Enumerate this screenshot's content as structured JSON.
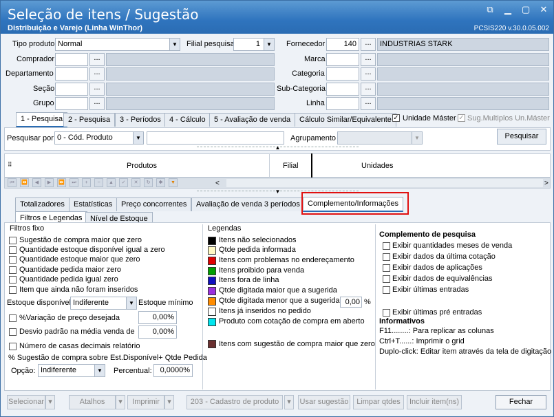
{
  "window": {
    "title": "Seleção de itens / Sugestão",
    "subtitle": "Distribuição e Varejo (Linha WinThor)",
    "version": "PCSIS220  v.30.0.05.002"
  },
  "filters": {
    "tipo_produto": {
      "label": "Tipo produto",
      "value": "Normal"
    },
    "filial": {
      "label": "Filial pesquisa",
      "value": "1"
    },
    "fornecedor": {
      "label": "Fornecedor",
      "code": "140",
      "name": "INDUSTRIAS STARK"
    },
    "comprador": "Comprador",
    "departamento": "Departamento",
    "secao": "Seção",
    "grupo": "Grupo",
    "marca": "Marca",
    "categoria": "Categoria",
    "subcategoria": "Sub-Categoria",
    "linha": "Linha",
    "dots": "..."
  },
  "tabs": [
    "1 - Pesquisa",
    "2 - Pesquisa",
    "3 - Períodos",
    "4 - Cálculo",
    "5 - Avaliação de venda",
    "Cálculo Similar/Equivalente"
  ],
  "unidade_master": "Unidade Máster",
  "sug_multiplos": "Sug.Multiplos Un.Máster",
  "search": {
    "label": "Pesquisar por",
    "value": "0 - Cód. Produto",
    "agrup_label": "Agrupamento",
    "button": "Pesquisar"
  },
  "grid": {
    "columns": [
      "Produtos",
      "Filial",
      "Unidades"
    ]
  },
  "bottom_tabs": [
    "Totalizadores",
    "Estatísticas",
    "Preço concorrentes",
    "Avaliação de venda 3 períodos",
    "Complemento/Informações"
  ],
  "sub_tabs": [
    "Filtros e Legendas",
    "Nível de Estoque"
  ],
  "filtros": {
    "title": "Filtros fixo",
    "items": [
      "Sugestão de compra maior que zero",
      "Quantidade estoque disponível igual a zero",
      "Quantidade estoque maior que zero",
      "Quantidade pedida maior zero",
      "Quantidade pedida igual zero",
      "Item que ainda não foram inseridos"
    ],
    "estoque_label": "Estoque disponível",
    "estoque_value": "Indiferente",
    "estoque_min": "Estoque mínimo",
    "variacao_label": "%Variação de preço desejada",
    "variacao_value": "0,00%",
    "desvio_label": "Desvio padrão na média venda de",
    "desvio_value": "0,00%",
    "casas_label": "Número de casas decimais relatório",
    "sugestao_label": "% Sugestão de compra sobre Est.Disponível+ Qtde Pedida",
    "opcao_label": "Opção:",
    "opcao_value": "Indiferente",
    "percentual_label": "Percentual:",
    "percentual_value": "0,0000%"
  },
  "legendas": {
    "title": "Legendas",
    "items": [
      {
        "color": "#000000",
        "label": "Itens não selecionados"
      },
      {
        "color": "#fff9c4",
        "label": "Qtde pedida informada"
      },
      {
        "color": "#e00000",
        "label": "Itens com problemas no endereçamento"
      },
      {
        "color": "#00a000",
        "label": "Itens proibido para venda"
      },
      {
        "color": "#1010c0",
        "label": "Itens fora de linha"
      },
      {
        "color": "#9b30e0",
        "label": "Qtde digitada maior que a sugerida"
      },
      {
        "color": "#ff8c00",
        "label": "Qtde digitada menor que a sugerida"
      },
      {
        "color": "#ffffff",
        "label": "Itens já inseridos no pedido"
      },
      {
        "color": "#00e5ee",
        "label": "Produto com cotação de compra em aberto"
      }
    ],
    "menor_value": "0,00",
    "menor_unit": "%",
    "extra": {
      "color": "#6b3030",
      "label": "Itens com sugestão de compra maior que zero"
    }
  },
  "complemento": {
    "title": "Complemento de pesquisa",
    "items": [
      "Exibir quantidades meses de venda",
      "Exibir dados da última cotação",
      "Exibir dados de aplicações",
      "Exibir dados de equivalências",
      "Exibir últimas entradas"
    ],
    "extra": "Exibir últimas pré entradas",
    "info_title": "Informativos",
    "info": [
      "F11........: Para replicar as colunas",
      "Ctrl+T......: Imprimir o grid",
      "Duplo-click: Editar item através da tela de digitação"
    ]
  },
  "buttons": {
    "selecionar": "Selecionar",
    "atalhos": "Atalhos",
    "imprimir": "Imprimir",
    "cadastro": "203 - Cadastro de produto",
    "usar": "Usar sugestão",
    "limpar": "Limpar qtdes",
    "incluir": "Incluir item(ns)",
    "fechar": "Fechar"
  },
  "colors": {
    "accent": "#2a6cb3",
    "highlight": "#e01010"
  }
}
